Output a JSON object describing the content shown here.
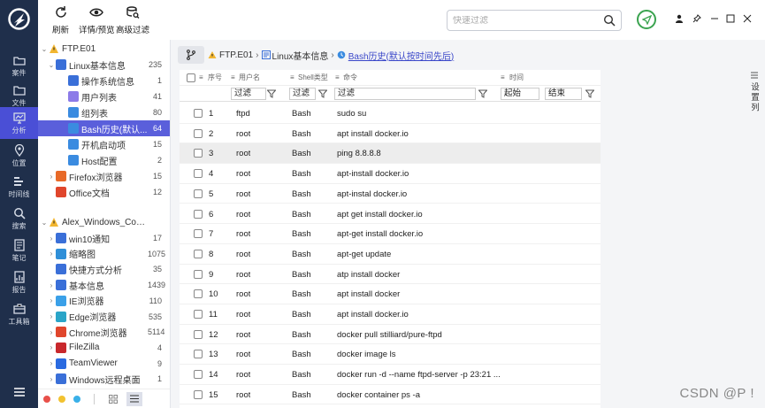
{
  "rail": {
    "items": [
      {
        "label": "案件",
        "icon": "folder-case-icon"
      },
      {
        "label": "文件",
        "icon": "file-icon"
      },
      {
        "label": "分析",
        "icon": "analysis-icon"
      },
      {
        "label": "位置",
        "icon": "location-icon"
      },
      {
        "label": "时间线",
        "icon": "timeline-icon"
      },
      {
        "label": "搜索",
        "icon": "search-icon"
      },
      {
        "label": "笔记",
        "icon": "note-icon"
      },
      {
        "label": "报告",
        "icon": "report-icon"
      },
      {
        "label": "工具箱",
        "icon": "toolbox-icon"
      }
    ],
    "active_index": 2
  },
  "toolbar": {
    "refresh_label": "刷新",
    "details_label": "详情/预览",
    "advanced_filter_label": "高级过滤",
    "search_placeholder": "快速过滤"
  },
  "tree": {
    "ftp_root": "FTP.E01",
    "linux_info": {
      "label": "Linux基本信息",
      "count": "235"
    },
    "linux_children": [
      {
        "label": "操作系统信息",
        "count": "1"
      },
      {
        "label": "用户列表",
        "count": "41"
      },
      {
        "label": "组列表",
        "count": "80"
      },
      {
        "label": "Bash历史(默认...",
        "count": "64"
      },
      {
        "label": "开机启动项",
        "count": "15"
      },
      {
        "label": "Host配置",
        "count": "2"
      }
    ],
    "firefox": {
      "label": "Firefox浏览器",
      "count": "15"
    },
    "office": {
      "label": "Office文档",
      "count": "12"
    },
    "win_root": "Alex_Windows_Compu...",
    "win_children": [
      {
        "label": "win10通知",
        "count": "17"
      },
      {
        "label": "缩略图",
        "count": "1075"
      },
      {
        "label": "快捷方式分析",
        "count": "35"
      },
      {
        "label": "基本信息",
        "count": "1439"
      },
      {
        "label": "IE浏览器",
        "count": "110"
      },
      {
        "label": "Edge浏览器",
        "count": "535"
      },
      {
        "label": "Chrome浏览器",
        "count": "5114"
      },
      {
        "label": "FileZilla",
        "count": "4"
      },
      {
        "label": "TeamViewer",
        "count": "9"
      },
      {
        "label": "Windows远程桌面",
        "count": "1"
      }
    ]
  },
  "breadcrumb": {
    "root": "FTP.E01",
    "mid": "Linux基本信息",
    "current": "Bash历史(默认按时间先后)"
  },
  "grid": {
    "headers": {
      "index": "序号",
      "user": "用户名",
      "shell": "Shell类型",
      "command": "命令",
      "time": "时间"
    },
    "filters": {
      "user": "过滤",
      "shell": "过滤",
      "command": "过滤",
      "start": "起始",
      "end": "结束"
    },
    "rows": [
      {
        "idx": "1",
        "user": "ftpd",
        "shell": "Bash",
        "cmd": "sudo su"
      },
      {
        "idx": "2",
        "user": "root",
        "shell": "Bash",
        "cmd": "apt install docker.io"
      },
      {
        "idx": "3",
        "user": "root",
        "shell": "Bash",
        "cmd": "ping 8.8.8.8"
      },
      {
        "idx": "4",
        "user": "root",
        "shell": "Bash",
        "cmd": "apt-install docker.io"
      },
      {
        "idx": "5",
        "user": "root",
        "shell": "Bash",
        "cmd": "apt-instal docker.io"
      },
      {
        "idx": "6",
        "user": "root",
        "shell": "Bash",
        "cmd": "apt get install docker.io"
      },
      {
        "idx": "7",
        "user": "root",
        "shell": "Bash",
        "cmd": "apt-get install docker.io"
      },
      {
        "idx": "8",
        "user": "root",
        "shell": "Bash",
        "cmd": "apt-get update"
      },
      {
        "idx": "9",
        "user": "root",
        "shell": "Bash",
        "cmd": "atp install docker"
      },
      {
        "idx": "10",
        "user": "root",
        "shell": "Bash",
        "cmd": "apt install docker"
      },
      {
        "idx": "11",
        "user": "root",
        "shell": "Bash",
        "cmd": "apt install docker.io"
      },
      {
        "idx": "12",
        "user": "root",
        "shell": "Bash",
        "cmd": "docker pull stilliard/pure-ftpd"
      },
      {
        "idx": "13",
        "user": "root",
        "shell": "Bash",
        "cmd": "docker image ls"
      },
      {
        "idx": "14",
        "user": "root",
        "shell": "Bash",
        "cmd": "docker run -d --name ftpd-server -p 23:21 ..."
      },
      {
        "idx": "15",
        "user": "root",
        "shell": "Bash",
        "cmd": "docker container ps -a"
      }
    ],
    "highlight_index": 2
  },
  "column_settings_label": "设置列",
  "watermark": "CSDN @P !",
  "colors": {
    "rail": "#1f2f4b",
    "accent": "#5a5fdb",
    "send": "#3aa34f"
  }
}
